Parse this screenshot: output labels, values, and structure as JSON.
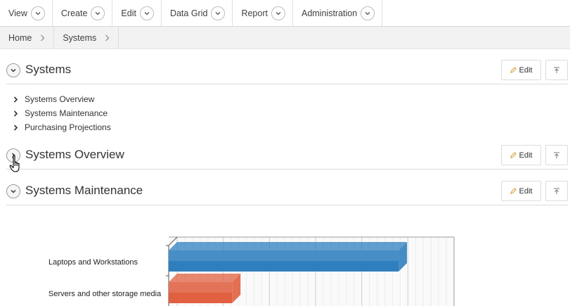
{
  "menu": [
    {
      "label": "View"
    },
    {
      "label": "Create"
    },
    {
      "label": "Edit"
    },
    {
      "label": "Data Grid"
    },
    {
      "label": "Report"
    },
    {
      "label": "Administration"
    }
  ],
  "breadcrumb": [
    {
      "label": "Home"
    },
    {
      "label": "Systems"
    }
  ],
  "regions": {
    "systems": {
      "title": "Systems",
      "edit_label": "Edit"
    },
    "overview": {
      "title": "Systems Overview",
      "edit_label": "Edit"
    },
    "maintenance": {
      "title": "Systems Maintenance",
      "edit_label": "Edit"
    }
  },
  "links": [
    {
      "label": "Systems Overview"
    },
    {
      "label": "Systems Maintenance"
    },
    {
      "label": "Purchasing Projections"
    }
  ],
  "chart_data": {
    "type": "bar",
    "orientation": "horizontal",
    "categories": [
      "Laptops and Workstations",
      "Servers and other storage media"
    ],
    "values": [
      58,
      16
    ],
    "xlim": [
      0,
      72
    ],
    "grid": true,
    "colors": [
      "#2f7fbf",
      "#e06040"
    ]
  }
}
